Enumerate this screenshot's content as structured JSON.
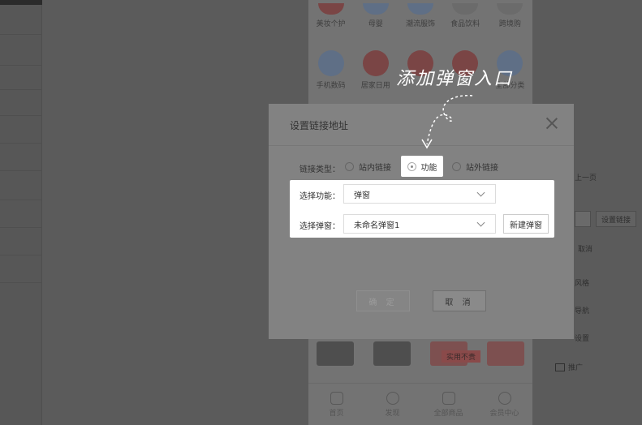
{
  "categories_row1": [
    "美妆个护",
    "母婴",
    "潮流服饰",
    "食品饮料",
    "跨境购"
  ],
  "categories_row2": [
    "手机数码",
    "居家日用",
    "",
    "",
    "全部分类"
  ],
  "annotation": "添加弹窗入口",
  "modal": {
    "title": "设置链接地址",
    "link_type_label": "链接类型：",
    "radio_internal": "站内链接",
    "radio_function": "功能",
    "radio_external": "站外链接",
    "select_function_label": "选择功能：",
    "select_function_value": "弹窗",
    "select_popup_label": "选择弹窗：",
    "select_popup_value": "未命名弹窗1",
    "new_popup_button": "新建弹窗",
    "confirm_button": "确 定",
    "cancel_button": "取 消"
  },
  "products": {
    "badge": "实用不贵"
  },
  "tabbar": [
    "首页",
    "发现",
    "全部商品",
    "会员中心"
  ],
  "right_panel": {
    "label_top": "上一页",
    "set_link_button": "设置链接",
    "cancel_button": "取消",
    "items": [
      "风格",
      "导航",
      "设置",
      "推广"
    ]
  }
}
